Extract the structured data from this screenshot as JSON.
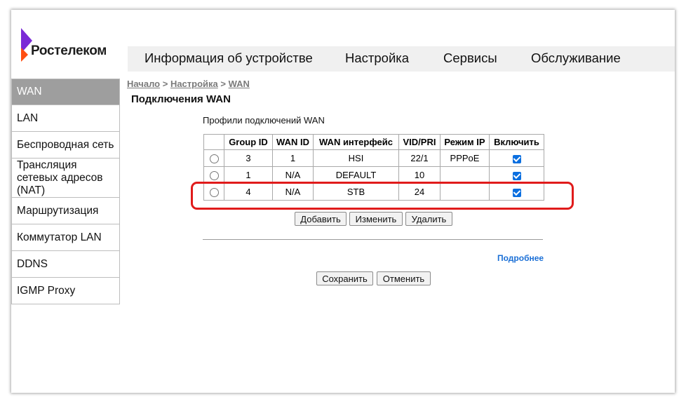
{
  "logo": {
    "brand": "Ростелеком",
    "colors": {
      "purple": "#7b2ad6",
      "orange": "#ff4f12"
    }
  },
  "topnav": {
    "items": [
      "Информация об устройстве",
      "Настройка",
      "Сервисы",
      "Обслуживание"
    ]
  },
  "sidebar": {
    "items": [
      {
        "label": "WAN",
        "active": true
      },
      {
        "label": "LAN"
      },
      {
        "label": "Беспроводная сеть"
      },
      {
        "label": "Трансляция сетевых адресов (NAT)"
      },
      {
        "label": "Маршрутизация"
      },
      {
        "label": "Коммутатор LAN"
      },
      {
        "label": "DDNS"
      },
      {
        "label": "IGMP Proxy"
      }
    ]
  },
  "breadcrumb": {
    "home": "Начало",
    "sep1": " > ",
    "settings": "Настройка",
    "sep2": " > ",
    "current": "WAN"
  },
  "page_title": "Подключения WAN",
  "subtitle": "Профили подключений WAN",
  "table": {
    "headers": [
      "Group ID",
      "WAN ID",
      "WAN интерфейс",
      "VID/PRI",
      "Режим IP",
      "Включить"
    ],
    "rows": [
      {
        "group_id": "3",
        "wan_id": "1",
        "iface": "HSI",
        "vid": "22/1",
        "mode": "PPPoE",
        "enabled": true
      },
      {
        "group_id": "1",
        "wan_id": "N/A",
        "iface": "DEFAULT",
        "vid": "10",
        "mode": "",
        "enabled": true
      },
      {
        "group_id": "4",
        "wan_id": "N/A",
        "iface": "STB",
        "vid": "24",
        "mode": "",
        "enabled": true
      }
    ]
  },
  "buttons": {
    "add": "Добавить",
    "edit": "Изменить",
    "delete": "Удалить",
    "save": "Сохранить",
    "cancel": "Отменить"
  },
  "more_link": "Подробнее",
  "highlight_color": "#e01b1b"
}
